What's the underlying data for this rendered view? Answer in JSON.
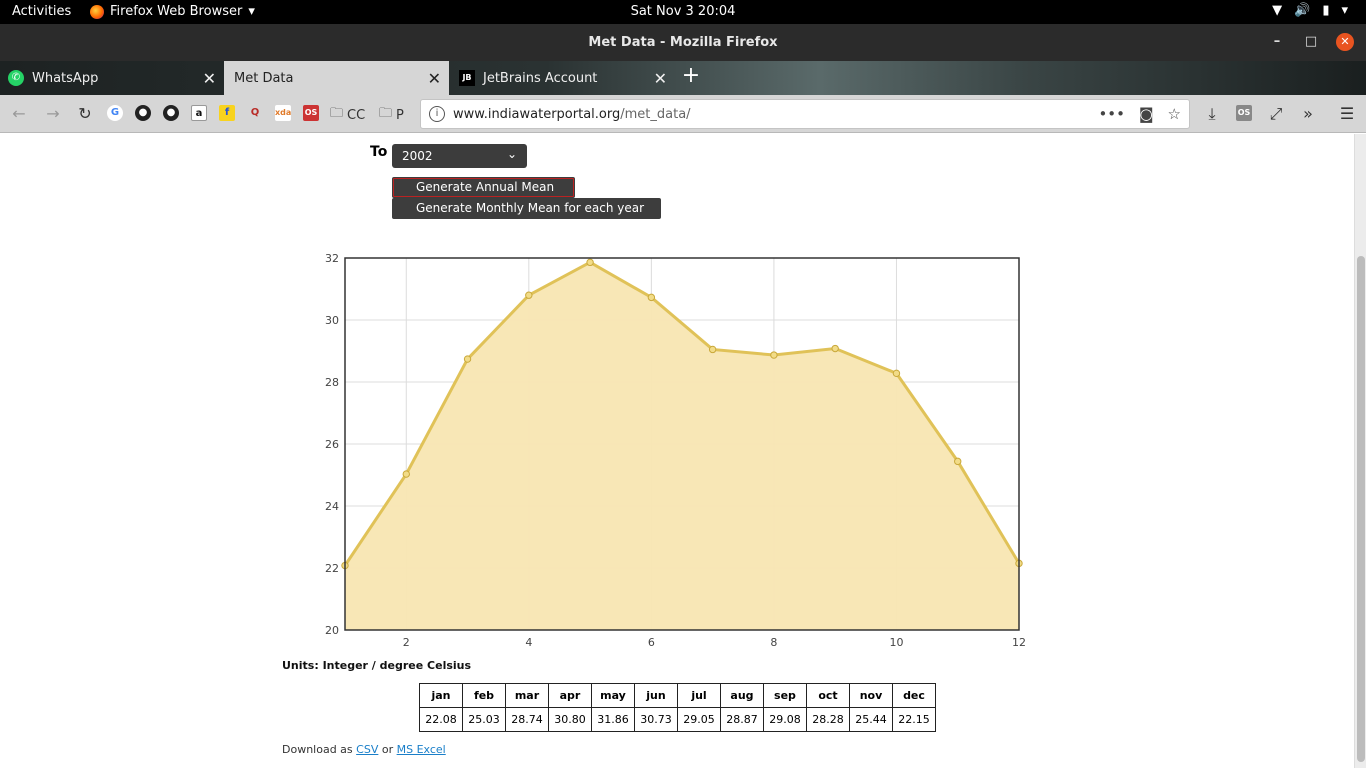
{
  "topbar": {
    "activities": "Activities",
    "app_name": "Firefox Web Browser",
    "clock": "Sat Nov 3  20:04"
  },
  "window": {
    "title": "Met Data - Mozilla Firefox"
  },
  "tabs": [
    {
      "label": "WhatsApp",
      "icon": "whatsapp-icon",
      "active": false
    },
    {
      "label": "Met Data",
      "icon": "",
      "active": true
    },
    {
      "label": "JetBrains Account",
      "icon": "jetbrains-icon",
      "active": false
    }
  ],
  "bookmarks": {
    "cc_label": "CC",
    "p_label": "P"
  },
  "urlbar": {
    "host": "www.indiawaterportal.org",
    "path": "/met_data/"
  },
  "form": {
    "to_label": "To",
    "year_selected": "2002",
    "annual_button": "Generate Annual Mean",
    "monthly_button": "Generate Monthly Mean for each year"
  },
  "chart_data": {
    "type": "area",
    "x": [
      1,
      2,
      3,
      4,
      5,
      6,
      7,
      8,
      9,
      10,
      11,
      12
    ],
    "values": [
      22.08,
      25.03,
      28.74,
      30.8,
      31.86,
      30.73,
      29.05,
      28.87,
      29.08,
      28.28,
      25.44,
      22.15
    ],
    "xlim": [
      1,
      12
    ],
    "ylim": [
      20,
      32
    ],
    "x_ticks": [
      2,
      4,
      6,
      8,
      10,
      12
    ],
    "y_ticks": [
      20,
      22,
      24,
      26,
      28,
      30,
      32
    ],
    "grid": true,
    "colors": {
      "line": "#e0c258",
      "fill": "#f8e6b2",
      "point": "#f2dc88"
    }
  },
  "units_label": "Units: Integer / degree Celsius",
  "table": {
    "headers": [
      "jan",
      "feb",
      "mar",
      "apr",
      "may",
      "jun",
      "jul",
      "aug",
      "sep",
      "oct",
      "nov",
      "dec"
    ],
    "values": [
      "22.08",
      "25.03",
      "28.74",
      "30.80",
      "31.86",
      "30.73",
      "29.05",
      "28.87",
      "29.08",
      "28.28",
      "25.44",
      "22.15"
    ]
  },
  "download": {
    "prefix": "Download as",
    "csv": "CSV",
    "or": "or",
    "excel": "MS Excel"
  }
}
